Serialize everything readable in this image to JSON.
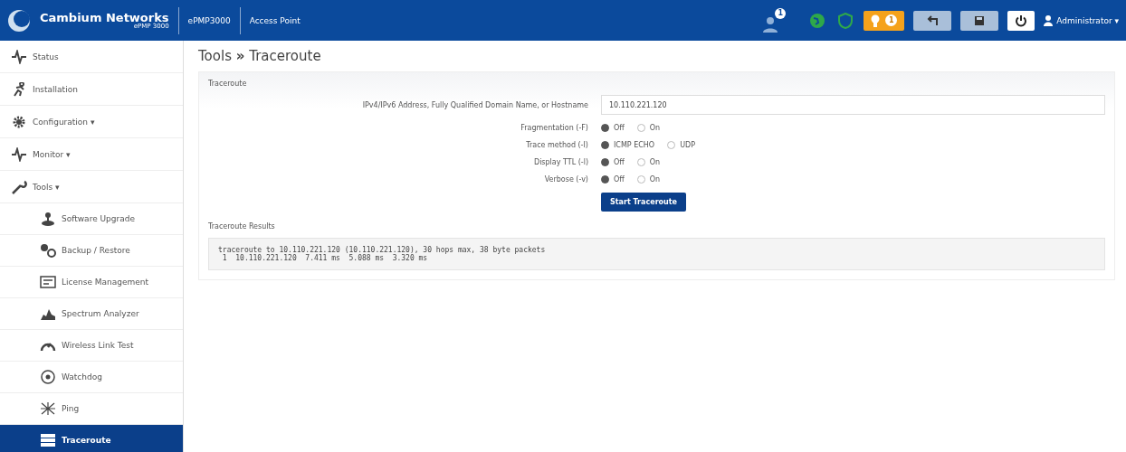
{
  "header": {
    "brand": "Cambium Networks",
    "model": "ePMP 3000",
    "device": "ePMP3000",
    "mode": "Access Point",
    "notification_count": "1",
    "alert_count": "1",
    "user": "Administrator ▾"
  },
  "sidebar": {
    "items": [
      {
        "label": "Status",
        "selected": false
      },
      {
        "label": "Installation",
        "selected": false
      },
      {
        "label": "Configuration ▾",
        "selected": false
      },
      {
        "label": "Monitor ▾",
        "selected": false
      },
      {
        "label": "Tools ▾",
        "selected": false,
        "children": [
          {
            "label": "Software Upgrade",
            "selected": false
          },
          {
            "label": "Backup / Restore",
            "selected": false
          },
          {
            "label": "License Management",
            "selected": false
          },
          {
            "label": "Spectrum Analyzer",
            "selected": false
          },
          {
            "label": "Wireless Link Test",
            "selected": false
          },
          {
            "label": "Watchdog",
            "selected": false
          },
          {
            "label": "Ping",
            "selected": false
          },
          {
            "label": "Traceroute",
            "selected": true
          }
        ]
      }
    ]
  },
  "breadcrumb": {
    "parent": "Tools",
    "separator": "»",
    "current": "Traceroute"
  },
  "form": {
    "title": "Traceroute",
    "address": {
      "label": "IPv4/IPv6 Address, Fully Qualified Domain Name, or Hostname",
      "value": "10.110.221.120"
    },
    "options": [
      {
        "label": "Fragmentation (-F)",
        "choices": [
          {
            "label": "Off",
            "selected": true
          },
          {
            "label": "On",
            "selected": false
          }
        ]
      },
      {
        "label": "Trace method (-I)",
        "choices": [
          {
            "label": "ICMP ECHO",
            "selected": true
          },
          {
            "label": "UDP",
            "selected": false
          }
        ]
      },
      {
        "label": "Display TTL (-l)",
        "choices": [
          {
            "label": "Off",
            "selected": true
          },
          {
            "label": "On",
            "selected": false
          }
        ]
      },
      {
        "label": "Verbose (-v)",
        "choices": [
          {
            "label": "Off",
            "selected": true
          },
          {
            "label": "On",
            "selected": false
          }
        ]
      }
    ],
    "button": "Start Traceroute"
  },
  "results": {
    "title": "Traceroute Results",
    "lines": [
      "traceroute to 10.110.221.120 (10.110.221.120), 30 hops max, 38 byte packets",
      " 1  10.110.221.120  7.411 ms  5.088 ms  3.320 ms"
    ]
  }
}
